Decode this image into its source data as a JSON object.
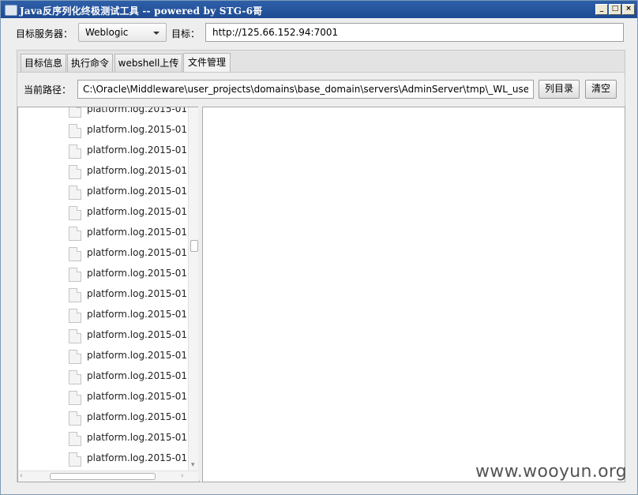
{
  "window": {
    "title": "Java反序列化终极测试工具  -- powered by STG-6哥",
    "controls": {
      "minimize": "_",
      "maximize": "□",
      "close": "×"
    }
  },
  "target": {
    "server_label": "目标服务器：",
    "server_value": "Weblogic",
    "target_label": "目标：",
    "target_value": "http://125.66.152.94:7001"
  },
  "tabs": [
    {
      "label": "目标信息",
      "active": false
    },
    {
      "label": "执行命令",
      "active": false
    },
    {
      "label": "webshell上传",
      "active": false
    },
    {
      "label": "文件管理",
      "active": true
    }
  ],
  "file_manager": {
    "path_label": "当前路径：",
    "path_value": "C:\\Oracle\\Middleware\\user_projects\\domains\\base_domain\\servers\\AdminServer\\tmp\\_WL_use",
    "list_button": "列目录",
    "clear_button": "清空",
    "files": [
      "platform.log.2015-01",
      "platform.log.2015-01",
      "platform.log.2015-01",
      "platform.log.2015-01",
      "platform.log.2015-01",
      "platform.log.2015-01",
      "platform.log.2015-01",
      "platform.log.2015-01",
      "platform.log.2015-01",
      "platform.log.2015-01",
      "platform.log.2015-01",
      "platform.log.2015-01",
      "platform.log.2015-01",
      "platform.log.2015-01",
      "platform.log.2015-01",
      "platform.log.2015-01",
      "platform.log.2015-01",
      "platform.log.2015-01"
    ]
  },
  "watermark": "www.wooyun.org"
}
